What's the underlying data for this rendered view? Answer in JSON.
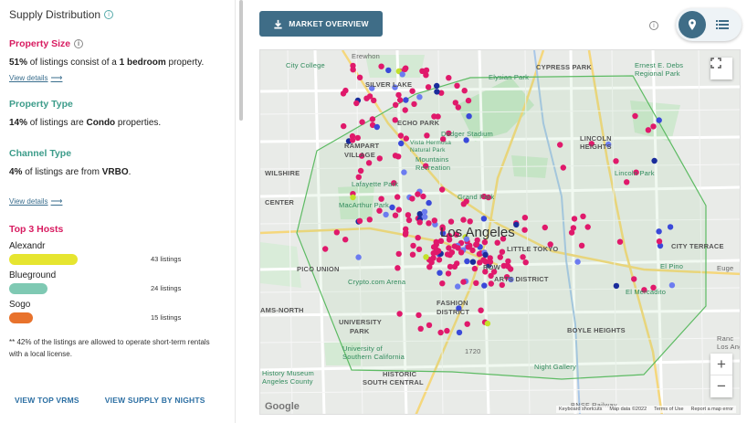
{
  "sidebar": {
    "title": "Supply Distribution",
    "property_size": {
      "heading": "Property Size",
      "pct": "51%",
      "text_mid": " of listings consist of a ",
      "bold": "1 bedroom",
      "text_end": " property.",
      "link": "View details"
    },
    "property_type": {
      "heading": "Property Type",
      "pct": "14%",
      "text_mid": " of listings are ",
      "bold": "Condo",
      "text_end": " properties."
    },
    "channel_type": {
      "heading": "Channel Type",
      "pct": "4%",
      "text_mid": " of listings are from ",
      "bold": "VRBO",
      "text_end": ".",
      "link": "View details"
    },
    "top_hosts": {
      "heading": "Top 3 Hosts",
      "hosts": [
        {
          "name": "Alexandr",
          "count": "43 listings",
          "value": 43,
          "color": "#e6e530"
        },
        {
          "name": "Blueground",
          "count": "24 listings",
          "value": 24,
          "color": "#7fc9b3"
        },
        {
          "name": "Sogo",
          "count": "15 listings",
          "value": 15,
          "color": "#e8722c"
        }
      ]
    },
    "note": "** 42% of the listings are allowed to operate short-term rentals with a local license.",
    "links": [
      "VIEW TOP VRMS",
      "VIEW SUPPLY BY NIGHTS"
    ]
  },
  "toolbar": {
    "market_overview": "MARKET OVERVIEW",
    "toggle_icons": [
      "map-pin-icon",
      "list-icon"
    ]
  },
  "map": {
    "city_label": "Los Angeles",
    "labels": {
      "silver_lake": "SILVER LAKE",
      "echo_park": "ECHO PARK",
      "rampart": "RAMPART",
      "village": "VILLAGE",
      "wilshire": "WILSHIRE",
      "center": "CENTER",
      "pico_union": "PICO UNION",
      "university": "UNIVERSITY",
      "park": "PARK",
      "historic": "HISTORIC",
      "south_central": "SOUTH CENTRAL",
      "fashion": "FASHION",
      "district": "DISTRICT",
      "arts_district": "ARTS DISTRICT",
      "boyle_heights": "BOYLE HEIGHTS",
      "lincoln_heights": "LINCOLN",
      "heights": "HEIGHTS",
      "city_terrace": "CITY TERRACE",
      "cypress_park": "CYPRESS PARK",
      "little_tokyo": "LITTLE TOKYO",
      "row": "ROW",
      "city_college": "City College",
      "lafayette_park": "Lafayette Park",
      "macarthur_park": "MacArthur Park",
      "dodger_stadium": "Dodger Stadium",
      "elysian_park": "Elysian Park",
      "lincoln_park": "Lincoln Park",
      "grand_park": "Grand Park",
      "crypto_arena": "Crypto.com Arena",
      "usc": "University of Southern California",
      "history_museum": "History Museum Angeles County",
      "night_gallery": "Night Gallery",
      "el_mercadito": "El Mercadito",
      "el_pino": "El Pino",
      "ernest_debs": "Ernest E. Debs Regional Park",
      "eugene": "Euge",
      "rancho": "Ranc",
      "ams_north": "AMS-NORTH",
      "erewhon": "Erewhon",
      "bnsf": "BNSF Railway",
      "route_1720": "1720",
      "mountains": "Mountains Recreation",
      "rows_vista": "Vista Hermosa Natural Park",
      "rancho_la": "Los Angeles"
    },
    "attribution": [
      "Keyboard shortcuts",
      "Map data ©2022",
      "Terms of Use",
      "Report a map error"
    ],
    "google": "Google",
    "zoom_in": "+",
    "zoom_out": "−",
    "fullscreen_icon": "fullscreen-icon",
    "marker_colors": {
      "pink": "#e0196b",
      "blue": "#3a49d9",
      "navy": "#1a2c9b",
      "lightblue": "#6c7cf0",
      "yellow": "#c3e02a"
    }
  }
}
